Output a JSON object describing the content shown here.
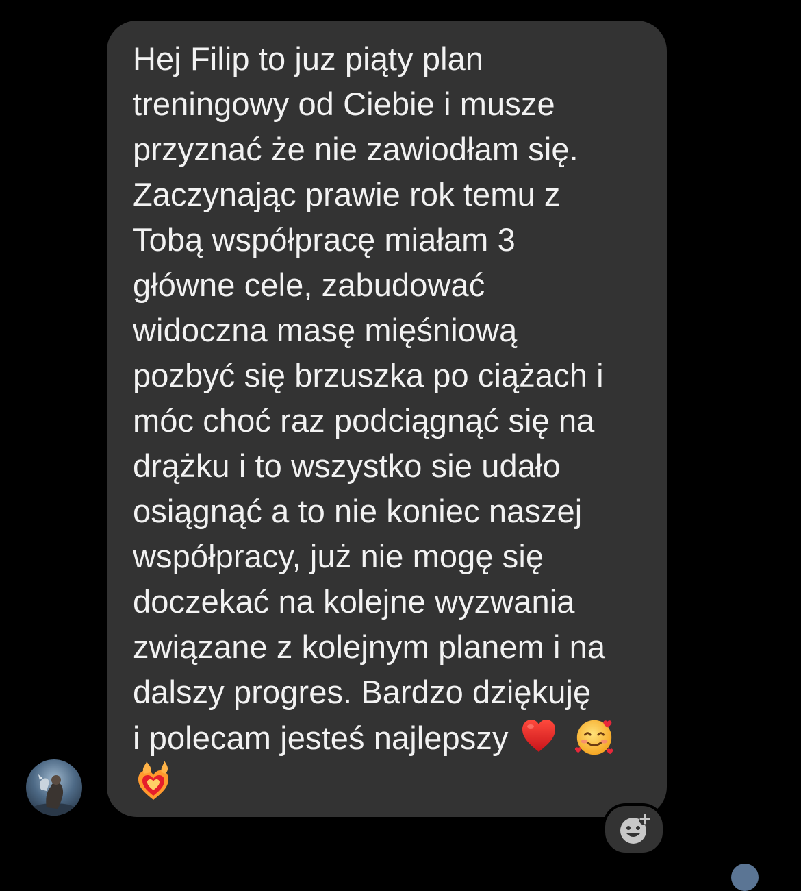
{
  "message": {
    "lines": [
      "Hej Filip to juz piąty plan",
      "treningowy od Ciebie i musze",
      "przyznać że nie zawiodłam się.",
      "Zaczynając prawie rok temu z",
      "Tobą współpracę miałam 3",
      "główne cele, zabudować",
      "widoczna masę mięśniową",
      "pozbyć się brzuszka po ciążach i",
      "móc choć raz podciągnąć się na",
      "drążku i to wszystko sie udało",
      "osiągnąć a to nie koniec naszej",
      "współpracy, już nie mogę się",
      "doczekać na kolejne wyzwania",
      "związane z kolejnym planem i na",
      "dalszy progres. Bardzo dziękuję",
      "i polecam jesteś najlepszy"
    ],
    "emojis": [
      "red-heart-emoji",
      "smiling-face-with-hearts-emoji",
      "heart-on-fire-emoji"
    ]
  },
  "colors": {
    "background": "#000000",
    "bubble": "#333333",
    "text": "#f2f2f2"
  },
  "icons": {
    "sender_avatar": "avatar",
    "reaction": "add-reaction-icon"
  }
}
